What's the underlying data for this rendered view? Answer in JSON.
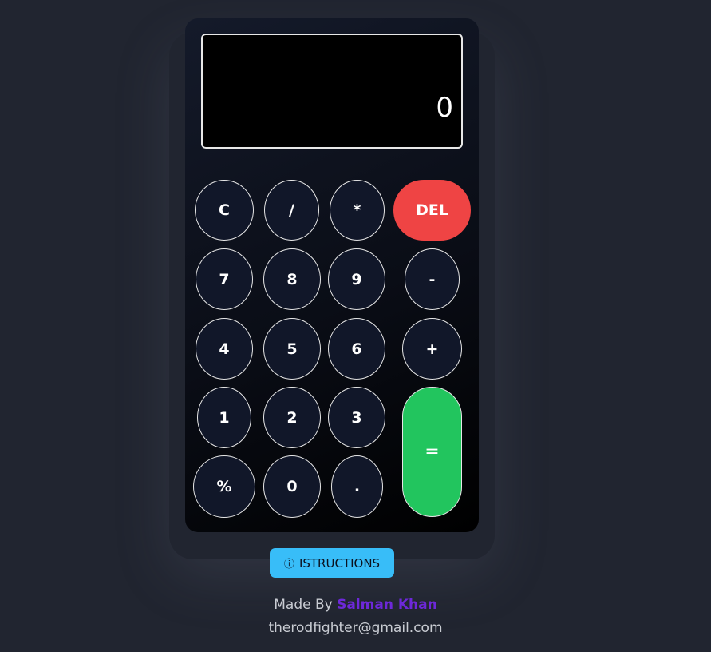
{
  "display": {
    "value": "0"
  },
  "keys": {
    "clear": "C",
    "divide": "/",
    "multiply": "*",
    "delete": "DEL",
    "seven": "7",
    "eight": "8",
    "nine": "9",
    "minus": "-",
    "four": "4",
    "five": "5",
    "six": "6",
    "plus": "+",
    "one": "1",
    "two": "2",
    "three": "3",
    "equals": "=",
    "percent": "%",
    "zero": "0",
    "dot": "."
  },
  "instructions": {
    "icon": "info-icon",
    "label": "ISTRUCTIONS"
  },
  "credit": {
    "prefix": "Made By",
    "author": "Salman Khan",
    "email": "therodfighter@gmail.com"
  },
  "colors": {
    "background": "#212530",
    "delete": "#ef4444",
    "equals": "#22c55e",
    "instructions": "#38bdf8",
    "author": "#6d28d9"
  }
}
